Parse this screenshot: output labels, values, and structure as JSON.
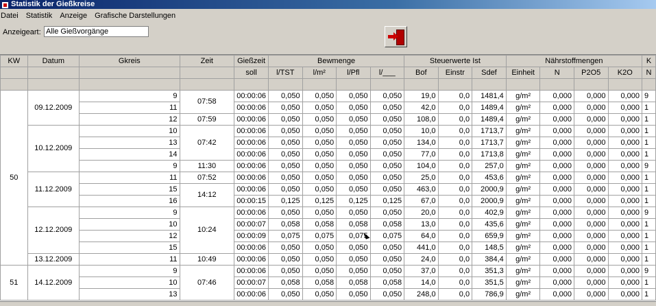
{
  "window": {
    "title": "Statistik der Gießkreise"
  },
  "menu": {
    "items": [
      "Datei",
      "Statistik",
      "Anzeige",
      "Grafische Darstellungen"
    ]
  },
  "filter": {
    "label": "Anzeigeart:",
    "value": "Alle Gießvorgänge"
  },
  "exit_button": {
    "icon": "exit-door-icon"
  },
  "table": {
    "header1": {
      "kw": "KW",
      "datum": "Datum",
      "gkreis": "Gkreis",
      "zeit": "Zeit",
      "giesszeit": "Gießzeit",
      "bewmenge": "Bewmenge",
      "steuerwerte": "Steuerwerte Ist",
      "naehrstoff": "Nährstoffmengen",
      "extra": "K"
    },
    "header2": [
      "soll",
      "l/TST",
      "l/m²",
      "l/Pfl",
      "l/___",
      "Bof",
      "Einstr",
      "Sdef",
      "Einheit",
      "N",
      "P2O5",
      "K2O",
      "N"
    ],
    "rows": [
      [
        "9",
        "00:00:06",
        "0,050",
        "0,050",
        "0,050",
        "0,050",
        "19,0",
        "0,0",
        "1481,4",
        "g/m²",
        "0,000",
        "0,000",
        "0,000",
        "9"
      ],
      [
        "11",
        "00:00:06",
        "0,050",
        "0,050",
        "0,050",
        "0,050",
        "42,0",
        "0,0",
        "1489,4",
        "g/m²",
        "0,000",
        "0,000",
        "0,000",
        "1"
      ],
      [
        "12",
        "00:00:06",
        "0,050",
        "0,050",
        "0,050",
        "0,050",
        "108,0",
        "0,0",
        "1489,4",
        "g/m²",
        "0,000",
        "0,000",
        "0,000",
        "1"
      ],
      [
        "10",
        "00:00:06",
        "0,050",
        "0,050",
        "0,050",
        "0,050",
        "10,0",
        "0,0",
        "1713,7",
        "g/m²",
        "0,000",
        "0,000",
        "0,000",
        "1"
      ],
      [
        "13",
        "00:00:06",
        "0,050",
        "0,050",
        "0,050",
        "0,050",
        "134,0",
        "0,0",
        "1713,7",
        "g/m²",
        "0,000",
        "0,000",
        "0,000",
        "1"
      ],
      [
        "14",
        "00:00:06",
        "0,050",
        "0,050",
        "0,050",
        "0,050",
        "77,0",
        "0,0",
        "1713,8",
        "g/m²",
        "0,000",
        "0,000",
        "0,000",
        "1"
      ],
      [
        "9",
        "00:00:06",
        "0,050",
        "0,050",
        "0,050",
        "0,050",
        "104,0",
        "0,0",
        "257,0",
        "g/m²",
        "0,000",
        "0,000",
        "0,000",
        "9"
      ],
      [
        "11",
        "00:00:06",
        "0,050",
        "0,050",
        "0,050",
        "0,050",
        "25,0",
        "0,0",
        "453,6",
        "g/m²",
        "0,000",
        "0,000",
        "0,000",
        "1"
      ],
      [
        "15",
        "00:00:06",
        "0,050",
        "0,050",
        "0,050",
        "0,050",
        "463,0",
        "0,0",
        "2000,9",
        "g/m²",
        "0,000",
        "0,000",
        "0,000",
        "1"
      ],
      [
        "16",
        "00:00:15",
        "0,125",
        "0,125",
        "0,125",
        "0,125",
        "67,0",
        "0,0",
        "2000,9",
        "g/m²",
        "0,000",
        "0,000",
        "0,000",
        "1"
      ],
      [
        "9",
        "00:00:06",
        "0,050",
        "0,050",
        "0,050",
        "0,050",
        "20,0",
        "0,0",
        "402,9",
        "g/m²",
        "0,000",
        "0,000",
        "0,000",
        "9"
      ],
      [
        "10",
        "00:00:07",
        "0,058",
        "0,058",
        "0,058",
        "0,058",
        "13,0",
        "0,0",
        "435,6",
        "g/m²",
        "0,000",
        "0,000",
        "0,000",
        "1"
      ],
      [
        "12",
        "00:00:09",
        "0,075",
        "0,075",
        "0,075",
        "0,075",
        "64,0",
        "0,0",
        "659,9",
        "g/m²",
        "0,000",
        "0,000",
        "0,000",
        "1"
      ],
      [
        "15",
        "00:00:06",
        "0,050",
        "0,050",
        "0,050",
        "0,050",
        "441,0",
        "0,0",
        "148,5",
        "g/m²",
        "0,000",
        "0,000",
        "0,000",
        "1"
      ],
      [
        "11",
        "00:00:06",
        "0,050",
        "0,050",
        "0,050",
        "0,050",
        "24,0",
        "0,0",
        "384,4",
        "g/m²",
        "0,000",
        "0,000",
        "0,000",
        "1"
      ],
      [
        "9",
        "00:00:06",
        "0,050",
        "0,050",
        "0,050",
        "0,050",
        "37,0",
        "0,0",
        "351,3",
        "g/m²",
        "0,000",
        "0,000",
        "0,000",
        "9"
      ],
      [
        "10",
        "00:00:07",
        "0,058",
        "0,058",
        "0,058",
        "0,058",
        "14,0",
        "0,0",
        "351,5",
        "g/m²",
        "0,000",
        "0,000",
        "0,000",
        "1"
      ],
      [
        "13",
        "00:00:06",
        "0,050",
        "0,050",
        "0,050",
        "0,050",
        "248,0",
        "0,0",
        "786,9",
        "g/m²",
        "0,000",
        "0,000",
        "0,000",
        "1"
      ]
    ],
    "kw_groups": [
      {
        "label": "50",
        "rows": 15
      },
      {
        "label": "51",
        "rows": 3
      }
    ],
    "date_groups": [
      {
        "label": "09.12.2009",
        "rows": 3
      },
      {
        "label": "10.12.2009",
        "rows": 4
      },
      {
        "label": "11.12.2009",
        "rows": 3
      },
      {
        "label": "12.12.2009",
        "rows": 4
      },
      {
        "label": "13.12.2009",
        "rows": 1
      },
      {
        "label": "14.12.2009",
        "rows": 3
      }
    ],
    "time_groups": [
      {
        "label": "07:58",
        "rows": 2
      },
      {
        "label": "07:59",
        "rows": 1
      },
      {
        "label": "07:42",
        "rows": 3
      },
      {
        "label": "11:30",
        "rows": 1
      },
      {
        "label": "07:52",
        "rows": 1
      },
      {
        "label": "14:12",
        "rows": 2
      },
      {
        "label": "10:24",
        "rows": 4
      },
      {
        "label": "10:49",
        "rows": 1
      },
      {
        "label": "07:46",
        "rows": 3
      }
    ]
  }
}
